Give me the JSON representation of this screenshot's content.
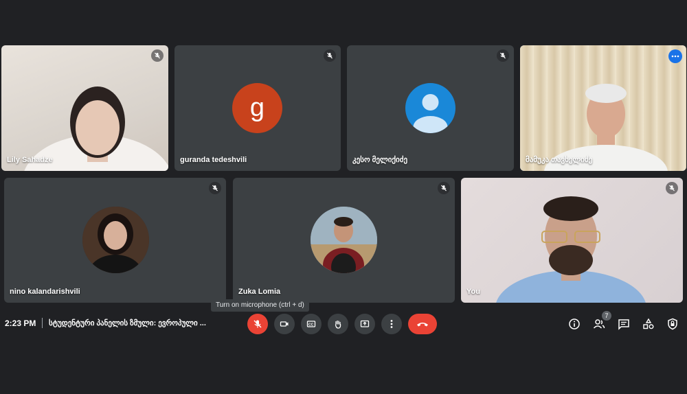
{
  "participants": [
    {
      "name": "Lily Sahadze",
      "muted": true,
      "video": true
    },
    {
      "name": "guranda tedeshvili",
      "muted": true,
      "avatar_letter": "g",
      "avatar_color": "#c8421c"
    },
    {
      "name": "კესო მელიქიძე",
      "muted": true,
      "avatar_color": "#1a88d8"
    },
    {
      "name": "მამუკა თავხელიძე",
      "muted": false,
      "active": true,
      "video": true
    },
    {
      "name": "nino kalandarishvili",
      "muted": true,
      "photo": true
    },
    {
      "name": "Zuka Lomia",
      "muted": true,
      "photo": true
    },
    {
      "name": "You",
      "muted": true,
      "video": true
    }
  ],
  "tooltip": "Turn on microphone (ctrl + d)",
  "bottom_bar": {
    "time": "2:23 PM",
    "meeting_title": "სტუდენტური პანელის ზმული: ევროპული ...",
    "people_count": "7",
    "controls": [
      "mic-off-icon",
      "camera-icon",
      "captions-icon",
      "raise-hand-icon",
      "present-icon",
      "more-vert-icon",
      "hang-up-icon"
    ],
    "right_icons": [
      "info-icon",
      "people-icon",
      "chat-icon",
      "activities-icon",
      "host-controls-icon"
    ]
  },
  "colors": {
    "background": "#202124",
    "tile": "#3c4043",
    "accent": "#8ab4f8",
    "danger": "#ea4335"
  }
}
